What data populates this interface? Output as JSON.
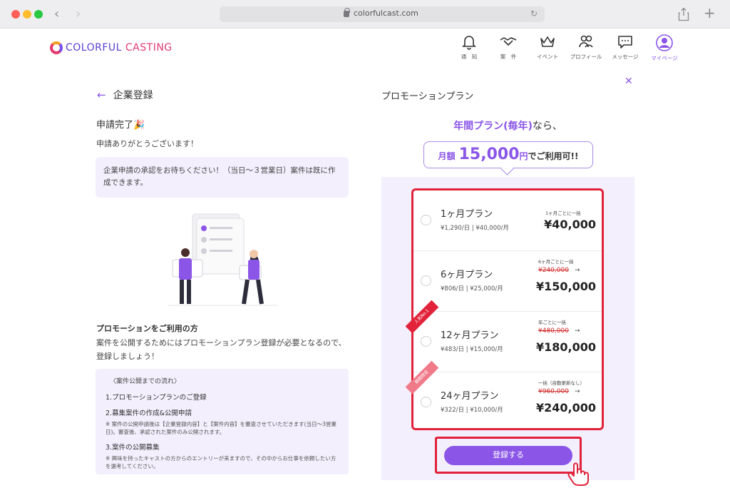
{
  "browser": {
    "url": "colorfulcast.com"
  },
  "site": {
    "logo_word1": "COLORFUL ",
    "logo_word2": "CASTING"
  },
  "topnav": [
    {
      "label": "通　知",
      "icon": "bell-icon"
    },
    {
      "label": "案　件",
      "icon": "handshake-icon"
    },
    {
      "label": "イベント",
      "icon": "crown-icon"
    },
    {
      "label": "プロフィール",
      "icon": "people-icon"
    },
    {
      "label": "メッセージ",
      "icon": "message-icon"
    },
    {
      "label": "マイページ",
      "icon": "user-icon"
    }
  ],
  "left": {
    "title": "企業登録",
    "complete_title": "申請完了🎉",
    "thanks": "申請ありがとうございます！",
    "info": "企業申請の承認をお待ちください！（当日〜３営業日）案件は既に作成できます。",
    "promo_heading": "プロモーションをご利用の方",
    "promo_desc": "案件を公開するためにはプロモーションプラン登録が必要となるので、登録しましょう！",
    "flow": {
      "head": "〈案件公開までの流れ〉",
      "step1": "1.プロモーションプランのご登録",
      "step2": "2.募集案件の作成&公開申請",
      "note2": "※ 案件の公開申請後は【企業登録内容】と【案件内容】を審査させていただきます(当日〜3営業日)。審査後、承認された案件のみ公開されます。",
      "step3": "3.案件の公開募集",
      "note3": "※ 興味を持ったキャストの方からのエントリーが来ますので、その中からお仕事を依頼したい方を選考してください。"
    }
  },
  "right": {
    "title": "プロモーションプラン",
    "annual_highlight": "年間プラン(毎年)",
    "annual_suffix": "なら、",
    "bubble_pre": "月額",
    "bubble_amount": "15,000",
    "bubble_unit": "円",
    "bubble_post": "でご利用可!!",
    "submit_label": "登録する"
  },
  "plans": [
    {
      "name": "1ヶ月プラン",
      "daily": "¥1,290/日 | ¥40,000/月",
      "note": "1ヶ月ごとに一括",
      "old_price": "",
      "price": "¥40,000",
      "ribbon": ""
    },
    {
      "name": "6ヶ月プラン",
      "daily": "¥806/日 | ¥25,000/月",
      "note": "6ヶ月ごとに一括",
      "old_price": "¥240,000",
      "price": "¥150,000",
      "ribbon": ""
    },
    {
      "name": "12ヶ月プラン",
      "daily": "¥483/日 | ¥15,000/月",
      "note": "年ごとに一括",
      "old_price": "¥480,000",
      "price": "¥180,000",
      "ribbon": "人気No.1"
    },
    {
      "name": "24ヶ月プラン",
      "daily": "¥322/日 | ¥10,000/月",
      "note": "一括（自動更新なし）",
      "old_price": "¥960,000",
      "price": "¥240,000",
      "ribbon": "期間限定"
    }
  ],
  "colors": {
    "accent": "#8b55e8",
    "highlight_border": "#e1223a",
    "panel_bg": "#f3effd"
  }
}
